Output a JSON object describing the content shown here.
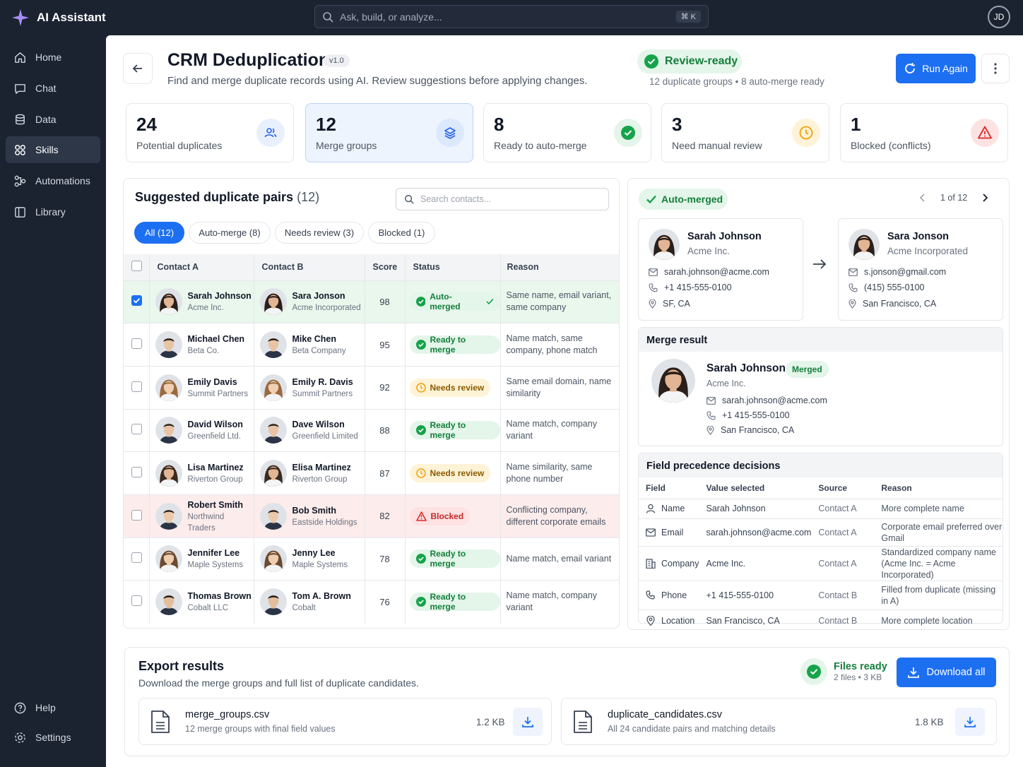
{
  "app": {
    "title": "AI Assistant",
    "search_placeholder": "Ask, build, or analyze...",
    "shortcut": "⌘ K",
    "user_initials": "JD"
  },
  "sidebar": {
    "items": [
      {
        "label": "Home",
        "icon": "home-icon"
      },
      {
        "label": "Chat",
        "icon": "chat-icon"
      },
      {
        "label": "Data",
        "icon": "database-icon"
      },
      {
        "label": "Skills",
        "icon": "skills-icon",
        "active": true
      },
      {
        "label": "Automations",
        "icon": "automations-icon"
      },
      {
        "label": "Library",
        "icon": "library-icon"
      }
    ],
    "bottom": [
      {
        "label": "Help",
        "icon": "help-icon"
      },
      {
        "label": "Settings",
        "icon": "gear-icon"
      }
    ]
  },
  "header": {
    "title": "CRM Deduplication",
    "version": "v1.0",
    "subtitle": "Find and merge duplicate records using AI. Review suggestions before applying changes.",
    "status": "Review-ready",
    "status_meta": "12 duplicate groups • 8 auto-merge ready",
    "run_label": "Run Again"
  },
  "stats": [
    {
      "value": "24",
      "label": "Potential duplicates",
      "icon": "users-icon",
      "color": "#2563eb"
    },
    {
      "value": "12",
      "label": "Merge groups",
      "icon": "layers-icon",
      "color": "#2563eb"
    },
    {
      "value": "8",
      "label": "Ready to auto-merge",
      "icon": "check-circle-icon",
      "color": "#16a34a"
    },
    {
      "value": "3",
      "label": "Need manual review",
      "icon": "clock-icon",
      "color": "#f59e0b"
    },
    {
      "value": "1",
      "label": "Blocked (conflicts)",
      "icon": "warning-icon",
      "color": "#dc2626"
    }
  ],
  "pairs": {
    "title": "Suggested duplicate pairs",
    "count": "(12)",
    "search_placeholder": "Search contacts...",
    "tabs": [
      "All (12)",
      "Auto-merge (8)",
      "Needs review (3)",
      "Blocked (1)"
    ],
    "columns": [
      "Contact A",
      "Contact B",
      "Score",
      "Status",
      "Reason"
    ],
    "rows": [
      {
        "a_name": "Sarah Johnson",
        "a_org": "Acme Inc.",
        "b_name": "Sara Jonson",
        "b_org": "Acme Incorporated",
        "score": "98",
        "status": "Auto-merged",
        "kind": "green",
        "reason": "Same name, email variant, same company",
        "selected": true
      },
      {
        "a_name": "Michael Chen",
        "a_org": "Beta Co.",
        "b_name": "Mike Chen",
        "b_org": "Beta Company",
        "score": "95",
        "status": "Ready to merge",
        "kind": "green",
        "reason": "Name match, same company, phone match"
      },
      {
        "a_name": "Emily Davis",
        "a_org": "Summit Partners",
        "b_name": "Emily R. Davis",
        "b_org": "Summit Partners",
        "score": "92",
        "status": "Needs review",
        "kind": "amber",
        "reason": "Same email domain, name similarity"
      },
      {
        "a_name": "David Wilson",
        "a_org": "Greenfield Ltd.",
        "b_name": "Dave Wilson",
        "b_org": "Greenfield Limited",
        "score": "88",
        "status": "Ready to merge",
        "kind": "green",
        "reason": "Name match, company variant"
      },
      {
        "a_name": "Lisa Martinez",
        "a_org": "Riverton Group",
        "b_name": "Elisa Martinez",
        "b_org": "Riverton Group",
        "score": "87",
        "status": "Needs review",
        "kind": "amber",
        "reason": "Name similarity, same phone number"
      },
      {
        "a_name": "Robert Smith",
        "a_org": "Northwind Traders",
        "b_name": "Bob Smith",
        "b_org": "Eastside Holdings",
        "score": "82",
        "status": "Blocked",
        "kind": "red",
        "reason": "Conflicting company, different corporate emails"
      },
      {
        "a_name": "Jennifer Lee",
        "a_org": "Maple Systems",
        "b_name": "Jenny Lee",
        "b_org": "Maple Systems",
        "score": "78",
        "status": "Ready to merge",
        "kind": "green",
        "reason": "Name match, email variant"
      },
      {
        "a_name": "Thomas Brown",
        "a_org": "Cobalt LLC",
        "b_name": "Tom A. Brown",
        "b_org": "Cobalt",
        "score": "76",
        "status": "Ready to merge",
        "kind": "green",
        "reason": "Name match, company variant"
      }
    ]
  },
  "detail": {
    "status": "Auto-merged",
    "pager": "1 of 12",
    "contact_a": {
      "name": "Sarah Johnson",
      "org": "Acme Inc.",
      "email": "sarah.johnson@acme.com",
      "phone": "+1 415-555-0100",
      "location": "SF, CA"
    },
    "contact_b": {
      "name": "Sara Jonson",
      "org": "Acme Incorporated",
      "email": "s.jonson@gmail.com",
      "phone": "(415) 555-0100",
      "location": "San Francisco, CA"
    },
    "merge_result": {
      "title": "Merge result",
      "name": "Sarah Johnson",
      "badge": "Merged",
      "org": "Acme Inc.",
      "email": "sarah.johnson@acme.com",
      "phone": "+1 415-555-0100",
      "location": "San Francisco, CA"
    },
    "precedence": {
      "title": "Field precedence decisions",
      "columns": [
        "Field",
        "Value selected",
        "Source",
        "Reason"
      ],
      "rows": [
        {
          "field": "Name",
          "icon": "user-icon",
          "value": "Sarah Johnson",
          "source": "Contact A",
          "reason": "More complete name"
        },
        {
          "field": "Email",
          "icon": "mail-icon",
          "value": "sarah.johnson@acme.com",
          "source": "Contact A",
          "reason": "Corporate email preferred over Gmail"
        },
        {
          "field": "Company",
          "icon": "building-icon",
          "value": "Acme Inc.",
          "source": "Contact A",
          "reason": "Standardized company name (Acme Inc. = Acme Incorporated)"
        },
        {
          "field": "Phone",
          "icon": "phone-icon",
          "value": "+1 415-555-0100",
          "source": "Contact B",
          "reason": "Filled from duplicate (missing in A)"
        },
        {
          "field": "Location",
          "icon": "pin-icon",
          "value": "San Francisco, CA",
          "source": "Contact B",
          "reason": "More complete location"
        }
      ]
    }
  },
  "export": {
    "title": "Export results",
    "subtitle": "Download the merge groups and full list of duplicate candidates.",
    "ready_title": "Files ready",
    "ready_meta": "2 files • 3 KB",
    "download_all": "Download all",
    "files": [
      {
        "name": "merge_groups.csv",
        "desc": "12 merge groups with final field values",
        "size": "1.2 KB"
      },
      {
        "name": "duplicate_candidates.csv",
        "desc": "All 24 candidate pairs and matching details",
        "size": "1.8 KB"
      }
    ]
  },
  "colors": {
    "accent": "#1d6ff2",
    "green": "#16a34a",
    "amber": "#f59e0b",
    "red": "#dc2626",
    "sidebar": "#1b2230"
  }
}
